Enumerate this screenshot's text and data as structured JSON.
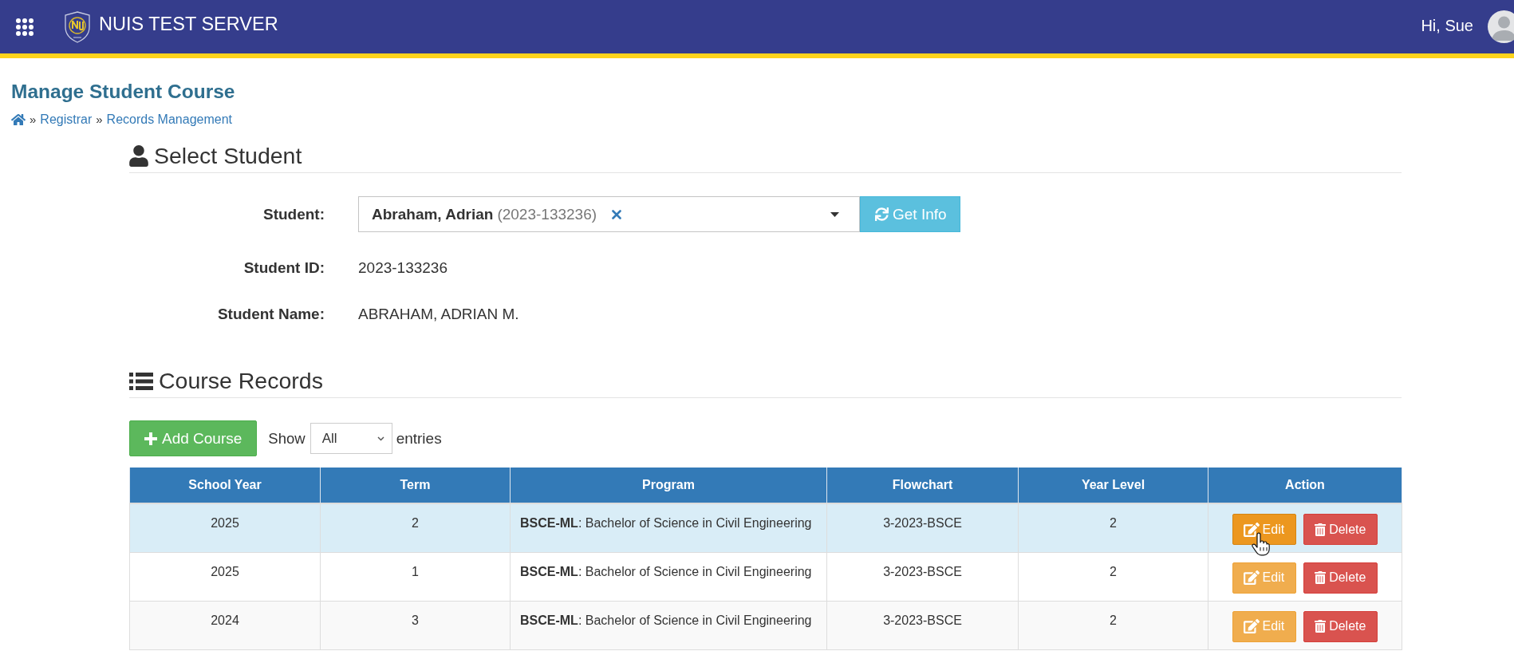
{
  "header": {
    "title": "NUIS TEST SERVER",
    "greeting": "Hi, Sue"
  },
  "page": {
    "title": "Manage Student Course",
    "breadcrumb": [
      {
        "kind": "home"
      },
      {
        "kind": "link",
        "separator": "»",
        "label": "Registrar"
      },
      {
        "kind": "link",
        "separator": "»",
        "label": "Records Management"
      }
    ]
  },
  "select_student": {
    "heading": "Select Student",
    "fields": [
      {
        "kind": "select",
        "label": "Student:",
        "value_name": "Abraham, Adrian",
        "value_id": "(2023-133236)",
        "clearable": true,
        "button": "Get Info"
      },
      {
        "kind": "text",
        "label": "Student ID:",
        "value": "2023-133236"
      },
      {
        "kind": "text",
        "label": "Student Name:",
        "value": "ABRAHAM, ADRIAN M."
      }
    ]
  },
  "course_records": {
    "heading": "Course Records",
    "add_button": "Add Course",
    "length_label": "Show",
    "length_value": "All",
    "length_suffix": "entries",
    "columns": [
      "School Year",
      "Term",
      "Program",
      "Flowchart",
      "Year Level",
      "Action"
    ],
    "rows": [
      {
        "hovered": true,
        "school_year": "2025",
        "term": "2",
        "program": "**BSCE-ML**: Bachelor of Science in Civil Engineering",
        "flowchart": "3-2023-BSCE",
        "year_level": "2",
        "actions": [
          {
            "kind": "edit",
            "label": "Edit",
            "hovered": true
          },
          {
            "kind": "delete",
            "label": "Delete",
            "hovered": false
          }
        ]
      },
      {
        "hovered": false,
        "school_year": "2025",
        "term": "1",
        "program": "**BSCE-ML**: Bachelor of Science in Civil Engineering",
        "flowchart": "3-2023-BSCE",
        "year_level": "2",
        "actions": [
          {
            "kind": "edit",
            "label": "Edit",
            "hovered": false
          },
          {
            "kind": "delete",
            "label": "Delete",
            "hovered": false
          }
        ]
      },
      {
        "hovered": false,
        "school_year": "2024",
        "term": "3",
        "program": "**BSCE-ML**: Bachelor of Science in Civil Engineering",
        "flowchart": "3-2023-BSCE",
        "year_level": "2",
        "actions": [
          {
            "kind": "edit",
            "label": "Edit",
            "hovered": false
          },
          {
            "kind": "delete",
            "label": "Delete",
            "hovered": false
          }
        ]
      }
    ]
  }
}
